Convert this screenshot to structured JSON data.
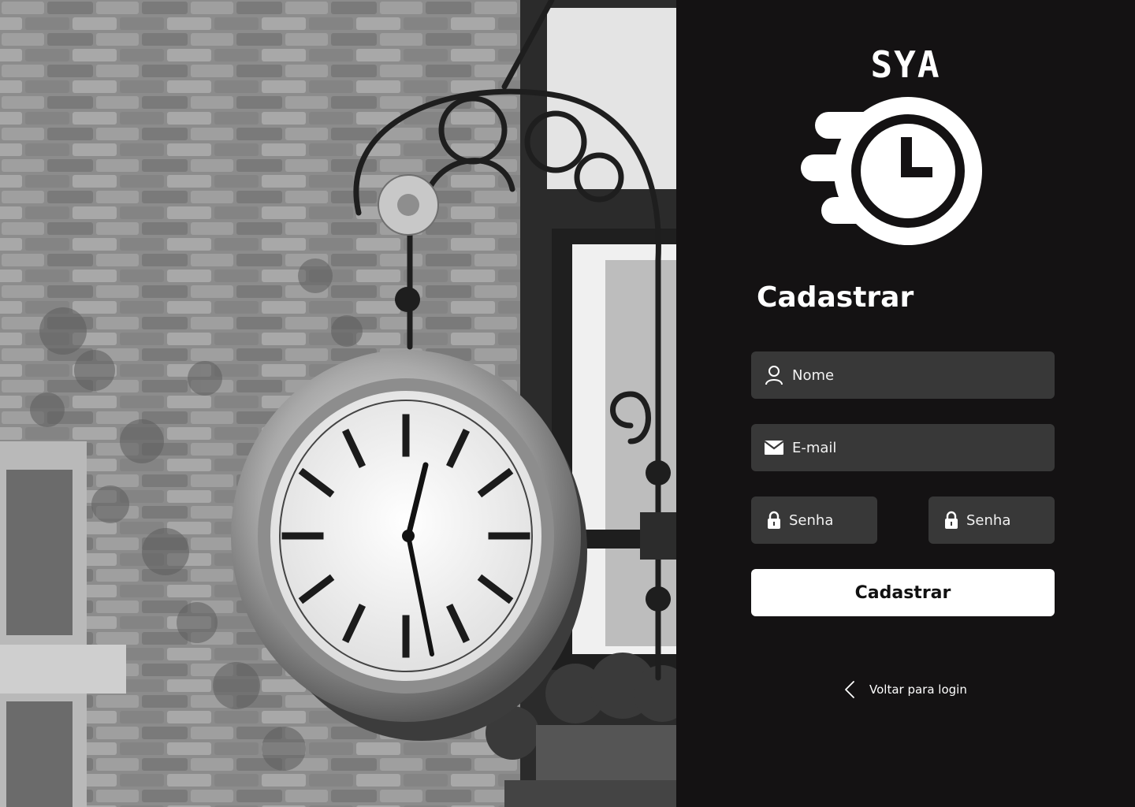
{
  "brand": {
    "wordmark": "SYA",
    "logo_icon": "speeding-clock-icon"
  },
  "form": {
    "title": "Cadastrar",
    "name_placeholder": "Nome",
    "name_icon": "user-icon",
    "email_placeholder": "E-mail",
    "email_icon": "envelope-icon",
    "password_placeholder": "Senha",
    "password_icon": "lock-icon",
    "confirm_password_placeholder": "Senha",
    "submit_label": "Cadastrar",
    "back_label": "Voltar para login",
    "back_icon": "chevron-left-icon"
  },
  "hero_image": {
    "subject": "hanging-street-clock-photo"
  },
  "colors": {
    "panel_background": "#141213",
    "input_background": "#383838",
    "button_background": "#ffffff",
    "button_text": "#111111",
    "text": "#ffffff"
  }
}
